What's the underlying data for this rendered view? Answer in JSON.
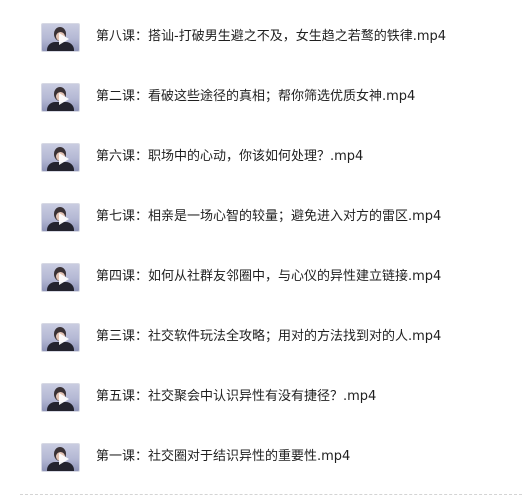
{
  "files": [
    {
      "name": "第八课：搭讪-打破男生避之不及，女生趋之若鹜的铁律.mp4",
      "thumbnail_icon": "video-thumbnail-icon"
    },
    {
      "name": "第二课：看破这些途径的真相；帮你筛选优质女神.mp4",
      "thumbnail_icon": "video-thumbnail-icon"
    },
    {
      "name": "第六课：职场中的心动，你该如何处理？.mp4",
      "thumbnail_icon": "video-thumbnail-icon"
    },
    {
      "name": "第七课：相亲是一场心智的较量；避免进入对方的雷区.mp4",
      "thumbnail_icon": "video-thumbnail-icon"
    },
    {
      "name": "第四课：如何从社群友邻圈中，与心仪的异性建立链接.mp4",
      "thumbnail_icon": "video-thumbnail-icon"
    },
    {
      "name": "第三课：社交软件玩法全攻略；用对的方法找到对的人.mp4",
      "thumbnail_icon": "video-thumbnail-icon"
    },
    {
      "name": "第五课：社交聚会中认识异性有没有捷径？.mp4",
      "thumbnail_icon": "video-thumbnail-icon"
    },
    {
      "name": "第一课：社交圈对于结识异性的重要性.mp4",
      "thumbnail_icon": "video-thumbnail-icon"
    }
  ]
}
